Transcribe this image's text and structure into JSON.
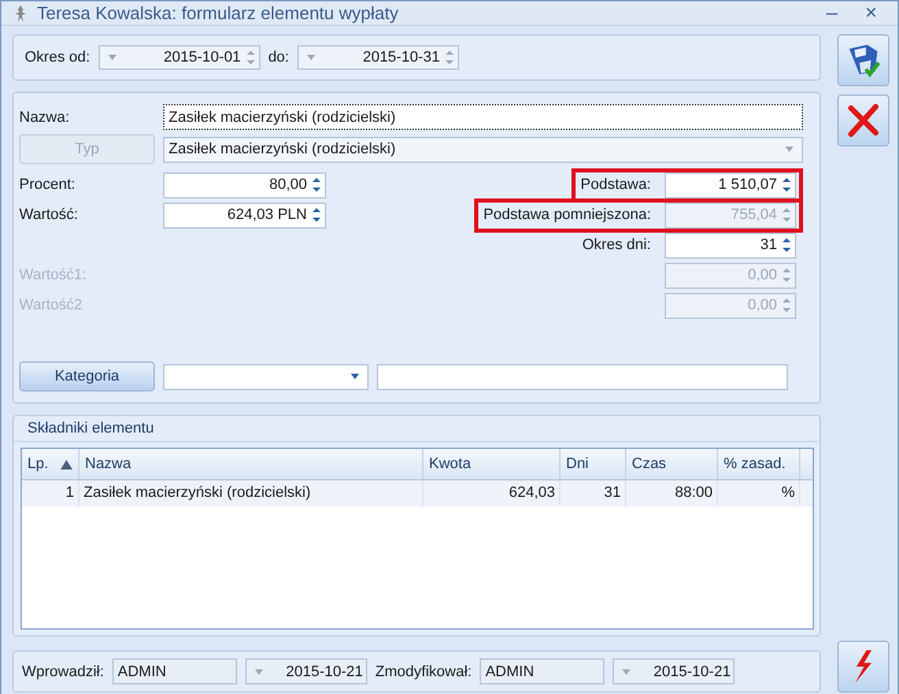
{
  "window": {
    "title": "Teresa Kowalska: formularz elementu wypłaty",
    "minimize": "–",
    "close": "×"
  },
  "period": {
    "from_label": "Okres od:",
    "from": "2015-10-01",
    "to_label": "do:",
    "to": "2015-10-31"
  },
  "name": {
    "label": "Nazwa:",
    "value": "Zasiłek macierzyński (rodzicielski)"
  },
  "type": {
    "button": "Typ",
    "disabled": true,
    "value": "Zasiłek macierzyński (rodzicielski)"
  },
  "rows": [
    {
      "left": {
        "label": "Procent:",
        "value": "80,00",
        "disabled": false
      },
      "right": {
        "label": "Podstawa:",
        "value": "1 510,07",
        "disabled": false,
        "highlighted": true
      }
    },
    {
      "left": {
        "label": "Wartość:",
        "value": "624,03 PLN",
        "disabled": false
      },
      "right": {
        "label": "Podstawa pomniejszona:",
        "value": "755,04",
        "disabled": true,
        "highlighted": true
      }
    },
    {
      "right": {
        "label": "Okres dni:",
        "value": "31",
        "disabled": false,
        "highlighted": false
      }
    },
    {
      "left": {
        "label": "Wartość1:",
        "disabled": true
      },
      "right": {
        "value": "0,00",
        "disabled": true,
        "highlighted": false
      }
    },
    {
      "left": {
        "label": "Wartość2",
        "disabled": true
      },
      "right": {
        "value": "0,00",
        "disabled": true,
        "highlighted": false
      }
    }
  ],
  "category": {
    "button": "Kategoria"
  },
  "components": {
    "title": "Składniki elementu",
    "columns": [
      "Lp.",
      "Nazwa",
      "Kwota",
      "Dni",
      "Czas",
      "% zasad."
    ],
    "rows": [
      [
        "1",
        "Zasiłek macierzyński (rodzicielski)",
        "624,03",
        "31",
        "88:00",
        "%"
      ]
    ]
  },
  "footer": {
    "created_label": "Wprowadził:",
    "created_by": "ADMIN",
    "created_on": "2015-10-21",
    "modified_label": "Zmodyfikował:",
    "modified_by": "ADMIN",
    "modified_on": "2015-10-21"
  }
}
